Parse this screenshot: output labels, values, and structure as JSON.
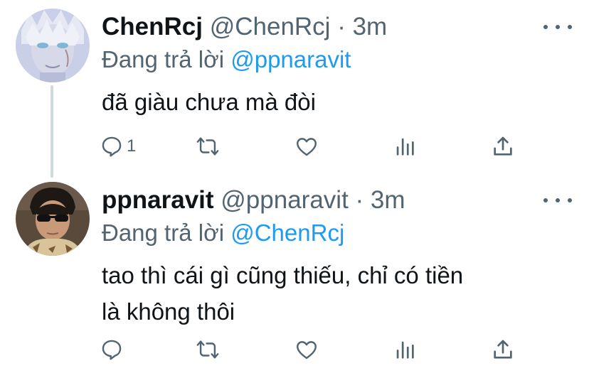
{
  "tweets": [
    {
      "name": "ChenRcj",
      "handle": "@ChenRcj",
      "separator": "·",
      "time": "3m",
      "replying_prefix": "Đang trả lời",
      "replying_to": "@ppnaravit",
      "lines": [
        "đã giàu chưa mà đòi"
      ],
      "reply_count": "1"
    },
    {
      "name": "ppnaravit",
      "handle": "@ppnaravit",
      "separator": "·",
      "time": "3m",
      "replying_prefix": "Đang trả lời",
      "replying_to": "@ChenRcj",
      "lines": [
        "tao thì cái gì cũng thiếu, chỉ có tiền",
        "là không thôi"
      ],
      "reply_count": ""
    }
  ],
  "colors": {
    "accent": "#1d9bf0",
    "secondary_text": "#536471",
    "primary_text": "#0f1419",
    "thread_line": "#cfd9de"
  },
  "icons": [
    "reply-icon",
    "retweet-icon",
    "like-icon",
    "analytics-icon",
    "share-icon",
    "more-icon"
  ]
}
